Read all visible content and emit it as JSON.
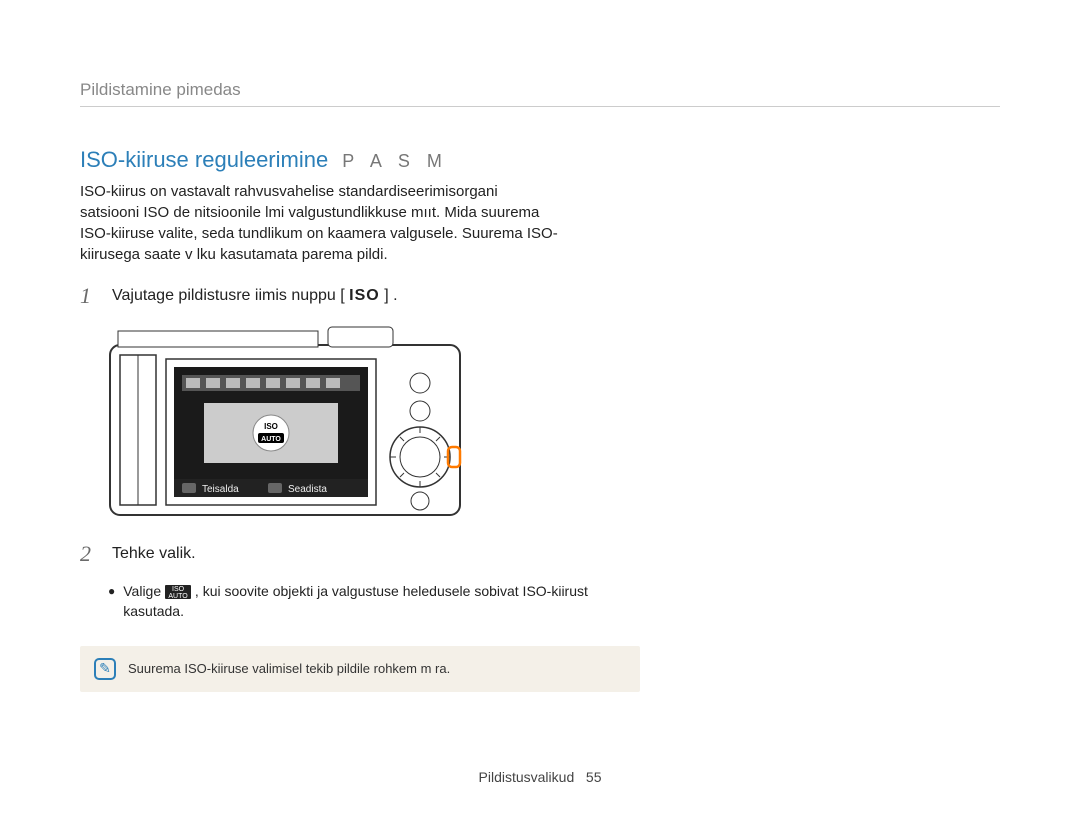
{
  "header": {
    "title": "Pildistamine pimedas"
  },
  "section": {
    "title": "ISO-kiiruse reguleerimine",
    "modes": "P A S M",
    "intro": "ISO-kiirus on vastavalt rahvusvahelise standardiseerimisorgani satsiooni ISO de nitsioonile  lmi valgustundlikkuse mııt. Mida suurema ISO-kiiruse valite, seda tundlikum on kaamera valgusele. Suurema ISO-kiirusega saate v lku kasutamata parema pildi."
  },
  "steps": [
    {
      "num": "1",
      "text_before": "Vajutage pildistusre iimis nuppu [",
      "button_label": "ISO",
      "text_after": "] ."
    },
    {
      "num": "2",
      "text": "Tehke valik."
    }
  ],
  "illustration": {
    "screen_bar_labels": {
      "teisalda": "Teisalda",
      "seadista": "Seadista"
    },
    "iso_label_top": "ISO",
    "iso_label_bottom": "AUTO"
  },
  "bullet": {
    "before": "Valige ",
    "after": ", kui soovite objekti ja valgustuse heledusele sobivat ISO-kiirust kasutada."
  },
  "note": {
    "text": "Suurema ISO-kiiruse valimisel tekib pildile rohkem m ra."
  },
  "footer": {
    "label": "Pildistusvalikud",
    "page": "55"
  }
}
